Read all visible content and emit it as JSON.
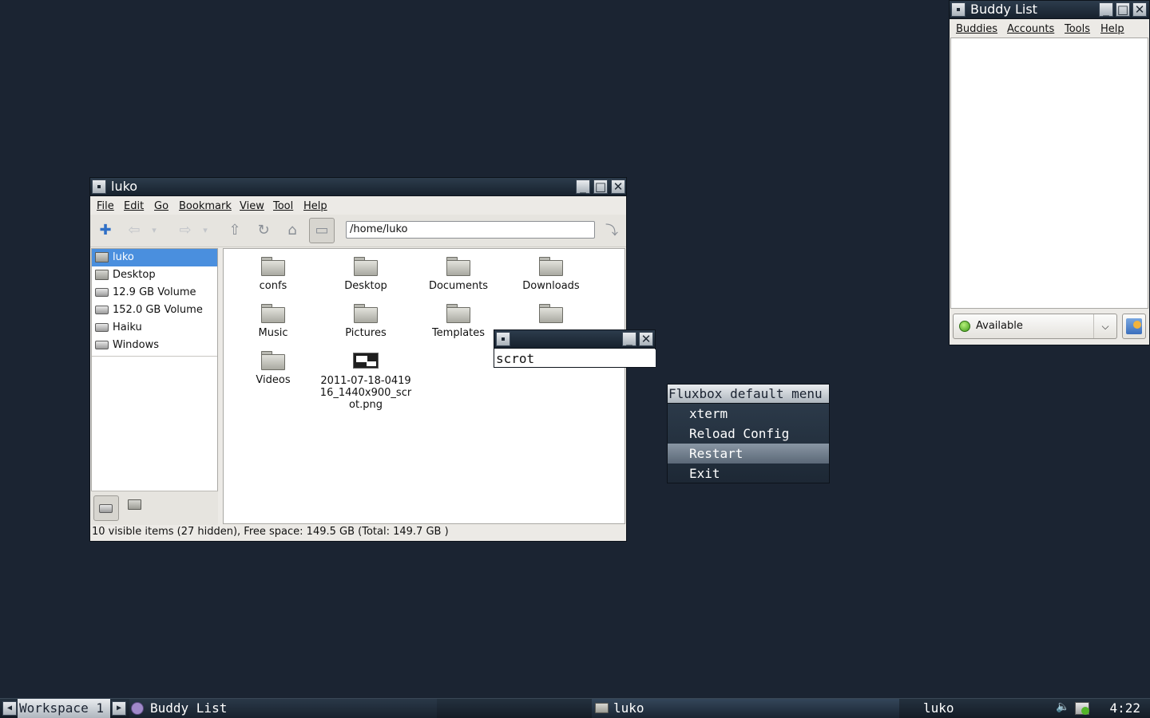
{
  "file_manager": {
    "title": "luko",
    "menu": [
      "File",
      "Edit",
      "Go",
      "Bookmark",
      "View",
      "Tool",
      "Help"
    ],
    "address": "/home/luko",
    "sidebar": [
      {
        "label": "luko",
        "icon": "home-folder-icon",
        "selected": true
      },
      {
        "label": "Desktop",
        "icon": "desktop-folder-icon",
        "selected": false
      },
      {
        "label": "12.9 GB Volume",
        "icon": "drive-icon",
        "selected": false
      },
      {
        "label": "152.0 GB Volume",
        "icon": "drive-icon",
        "selected": false
      },
      {
        "label": "Haiku",
        "icon": "drive-icon",
        "selected": false
      },
      {
        "label": "Windows",
        "icon": "drive-icon",
        "selected": false
      }
    ],
    "files": [
      {
        "name": "confs",
        "type": "folder"
      },
      {
        "name": "Desktop",
        "type": "folder"
      },
      {
        "name": "Documents",
        "type": "folder"
      },
      {
        "name": "Downloads",
        "type": "folder"
      },
      {
        "name": "Music",
        "type": "folder"
      },
      {
        "name": "Pictures",
        "type": "folder"
      },
      {
        "name": "Templates",
        "type": "folder"
      },
      {
        "name": "",
        "type": "folder"
      },
      {
        "name": "Videos",
        "type": "folder"
      },
      {
        "name": "2011-07-18-041916_1440x900_scrot.png",
        "type": "image"
      }
    ],
    "file_lines": {
      "png": [
        "2011-07-18-0419",
        "16_1440x900_scr",
        "ot.png"
      ]
    },
    "status": "10 visible items (27 hidden), Free space: 149.5 GB (Total: 149.7 GB )"
  },
  "run_dialog": {
    "value": "scrot"
  },
  "fluxbox_menu": {
    "title": "Fluxbox default menu",
    "items": [
      {
        "label": "xterm",
        "highlighted": false
      },
      {
        "label": "Reload Config",
        "highlighted": false
      },
      {
        "label": "Restart",
        "highlighted": true
      },
      {
        "label": "Exit",
        "highlighted": false
      }
    ]
  },
  "buddy_list": {
    "title": "Buddy List",
    "menu": [
      "Buddies",
      "Accounts",
      "Tools",
      "Help"
    ],
    "status": "Available"
  },
  "taskbar": {
    "workspace": "Workspace 1",
    "tasks": [
      "Buddy List",
      "luko",
      "luko"
    ],
    "clock": "4:22"
  },
  "colors": {
    "desktop": "#1b2432",
    "selection": "#4a8fde",
    "titlebar": "#17212d"
  }
}
